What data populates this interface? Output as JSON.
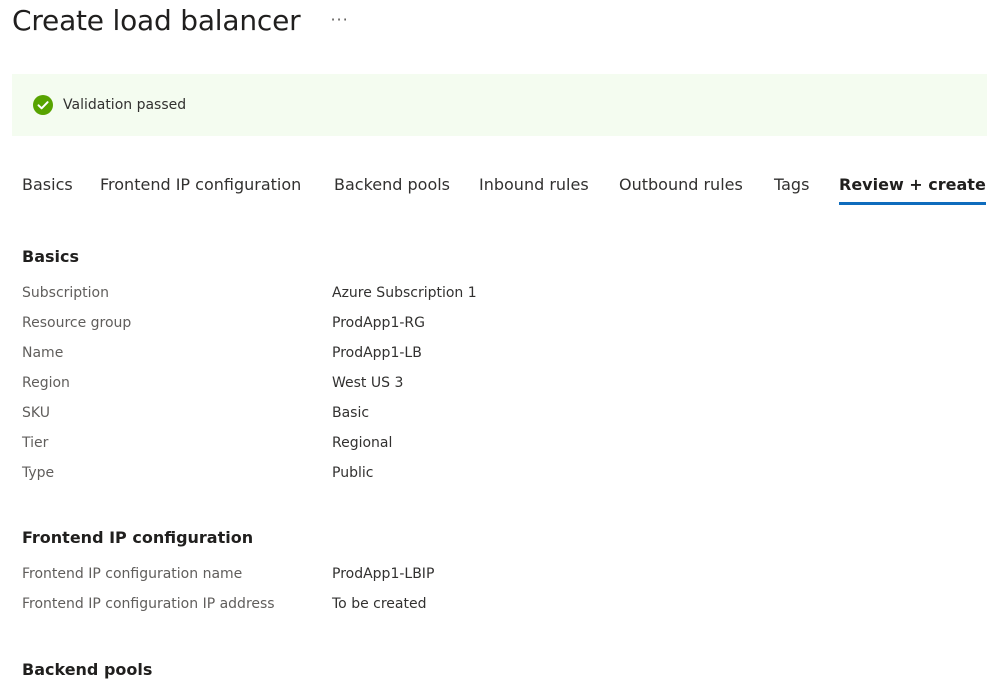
{
  "header": {
    "title": "Create load balancer",
    "more_label": "···"
  },
  "validation": {
    "text": "Validation passed",
    "icon": "check-circle-icon",
    "color": "#57a300"
  },
  "tabs": [
    {
      "label": "Basics"
    },
    {
      "label": "Frontend IP configuration"
    },
    {
      "label": "Backend pools"
    },
    {
      "label": "Inbound rules"
    },
    {
      "label": "Outbound rules"
    },
    {
      "label": "Tags"
    },
    {
      "label": "Review + create",
      "active": true
    }
  ],
  "sections": {
    "basics": {
      "title": "Basics",
      "rows": [
        {
          "label": "Subscription",
          "value": "Azure Subscription 1"
        },
        {
          "label": "Resource group",
          "value": "ProdApp1-RG"
        },
        {
          "label": "Name",
          "value": "ProdApp1-LB"
        },
        {
          "label": "Region",
          "value": "West US 3"
        },
        {
          "label": "SKU",
          "value": "Basic"
        },
        {
          "label": "Tier",
          "value": "Regional"
        },
        {
          "label": "Type",
          "value": "Public"
        }
      ]
    },
    "frontend": {
      "title": "Frontend IP configuration",
      "rows": [
        {
          "label": "Frontend IP configuration name",
          "value": "ProdApp1-LBIP"
        },
        {
          "label": "Frontend IP configuration IP address",
          "value": "To be created"
        }
      ]
    },
    "backend": {
      "title": "Backend pools"
    }
  },
  "colors": {
    "accent": "#0f6cbd",
    "success_bg": "#f4fcf0"
  }
}
